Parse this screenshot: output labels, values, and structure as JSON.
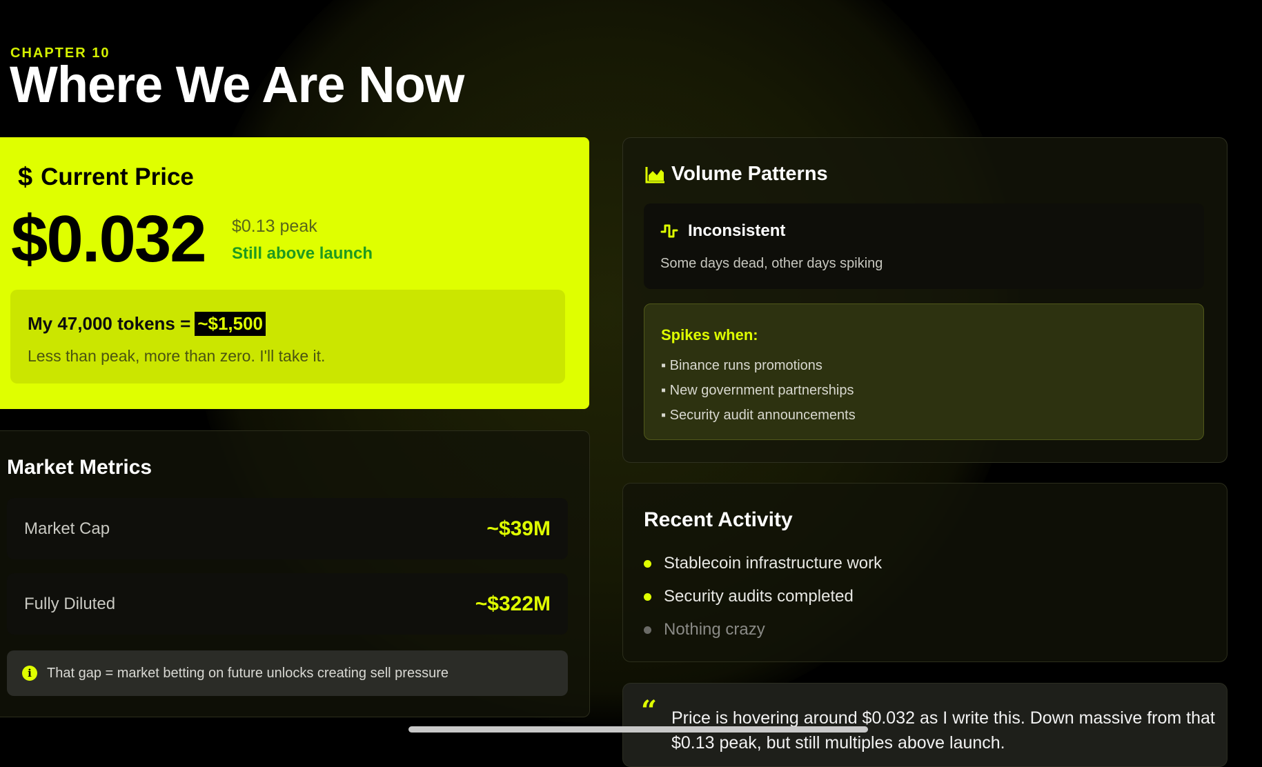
{
  "chapter": "CHAPTER 10",
  "title": "Where We Are Now",
  "price_card": {
    "heading": "Current Price",
    "icon": "dollar-icon",
    "price": "$0.032",
    "peak": "$0.13 peak",
    "status": "Still above launch",
    "tokens_label": "My 47,000 tokens =",
    "tokens_value": "~$1,500",
    "tokens_sub": "Less than peak, more than zero. I'll take it."
  },
  "metrics": {
    "title": "Market Metrics",
    "rows": [
      {
        "label": "Market Cap",
        "value": "~$39M"
      },
      {
        "label": "Fully Diluted",
        "value": "~$322M"
      }
    ],
    "note": "That gap = market betting on future unlocks creating sell pressure"
  },
  "volume": {
    "title": "Volume Patterns",
    "icon": "area-chart-icon",
    "inconsistent_title": "Inconsistent",
    "inconsistent_icon": "step-wave-icon",
    "inconsistent_sub": "Some days dead, other days spiking",
    "spikes_title": "Spikes when:",
    "spikes": [
      "▪ Binance runs promotions",
      "▪ New government partnerships",
      "▪ Security audit announcements"
    ]
  },
  "activity": {
    "title": "Recent Activity",
    "items": [
      "Stablecoin infrastructure work",
      "Security audits completed",
      "Nothing crazy"
    ]
  },
  "quote": {
    "text": "Price is hovering around $0.032 as I write this. Down massive from that $0.13 peak, but still multiples above launch."
  },
  "colors": {
    "accent": "#dfff00",
    "background": "#000000",
    "positive": "#1f9a1f"
  }
}
